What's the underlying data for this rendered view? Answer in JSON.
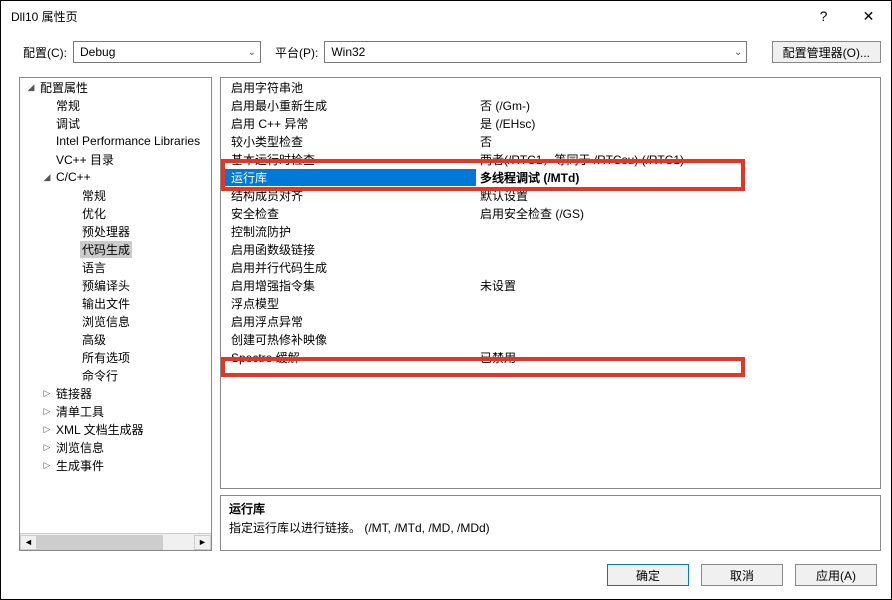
{
  "titlebar": {
    "title": "Dll10 属性页",
    "help": "?",
    "close": "✕"
  },
  "toprow": {
    "config_label": "配置(C):",
    "config_value": "Debug",
    "platform_label": "平台(P):",
    "platform_value": "Win32",
    "mgr_button": "配置管理器(O)..."
  },
  "tree": [
    {
      "indent": 0,
      "toggle": "�開",
      "label": "配置属性"
    },
    {
      "indent": 1,
      "toggle": "",
      "label": "常规"
    },
    {
      "indent": 1,
      "toggle": "",
      "label": "调试"
    },
    {
      "indent": 1,
      "toggle": "",
      "label": "Intel Performance Libraries"
    },
    {
      "indent": 1,
      "toggle": "",
      "label": "VC++ 目录"
    },
    {
      "indent": 1,
      "toggle": "▼",
      "label": "C/C++"
    },
    {
      "indent": 2,
      "toggle": "",
      "label": "常规"
    },
    {
      "indent": 2,
      "toggle": "",
      "label": "优化"
    },
    {
      "indent": 2,
      "toggle": "",
      "label": "预处理器"
    },
    {
      "indent": 2,
      "toggle": "",
      "label": "代码生成",
      "selected": true
    },
    {
      "indent": 2,
      "toggle": "",
      "label": "语言"
    },
    {
      "indent": 2,
      "toggle": "",
      "label": "预编译头"
    },
    {
      "indent": 2,
      "toggle": "",
      "label": "输出文件"
    },
    {
      "indent": 2,
      "toggle": "",
      "label": "浏览信息"
    },
    {
      "indent": 2,
      "toggle": "",
      "label": "高级"
    },
    {
      "indent": 2,
      "toggle": "",
      "label": "所有选项"
    },
    {
      "indent": 2,
      "toggle": "",
      "label": "命令行"
    },
    {
      "indent": 1,
      "toggle": "▶",
      "label": "链接器"
    },
    {
      "indent": 1,
      "toggle": "▶",
      "label": "清单工具"
    },
    {
      "indent": 1,
      "toggle": "▶",
      "label": "XML 文档生成器"
    },
    {
      "indent": 1,
      "toggle": "▶",
      "label": "浏览信息"
    },
    {
      "indent": 1,
      "toggle": "▶",
      "label": "生成事件"
    }
  ],
  "grid": [
    {
      "label": "启用字符串池",
      "value": ""
    },
    {
      "label": "启用最小重新生成",
      "value": "否 (/Gm-)"
    },
    {
      "label": "启用 C++ 异常",
      "value": "是 (/EHsc)"
    },
    {
      "label": "较小类型检查",
      "value": "否"
    },
    {
      "label": "基本运行时检查",
      "value": "两者(/RTC1，等同于 /RTCsu) (/RTC1)"
    },
    {
      "label": "运行库",
      "value": "多线程调试 (/MTd)",
      "selected": true
    },
    {
      "label": "结构成员对齐",
      "value": "默认设置"
    },
    {
      "label": "安全检查",
      "value": "启用安全检查 (/GS)"
    },
    {
      "label": "控制流防护",
      "value": ""
    },
    {
      "label": "启用函数级链接",
      "value": ""
    },
    {
      "label": "启用并行代码生成",
      "value": ""
    },
    {
      "label": "启用增强指令集",
      "value": "未设置"
    },
    {
      "label": "浮点模型",
      "value": ""
    },
    {
      "label": "启用浮点异常",
      "value": ""
    },
    {
      "label": "创建可热修补映像",
      "value": ""
    },
    {
      "label": "Spectre 缓解",
      "value": "已禁用"
    }
  ],
  "desc": {
    "title": "运行库",
    "body": "指定运行库以进行链接。     (/MT, /MTd, /MD, /MDd)"
  },
  "footer": {
    "ok": "确定",
    "cancel": "取消",
    "apply": "应用(A)"
  }
}
